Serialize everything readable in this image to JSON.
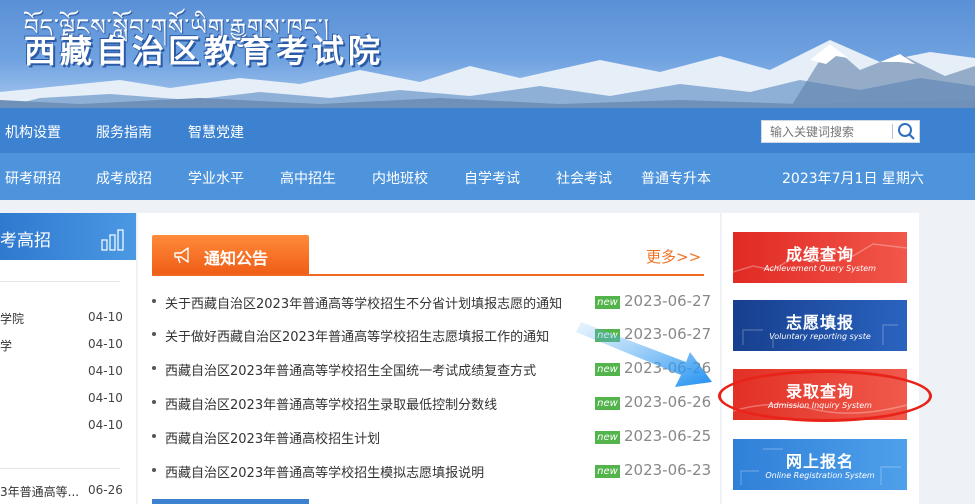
{
  "header": {
    "tibetan_title": "བོད་ལྗོངས་སློབ་གསོ་ཡིག་རྒྱུགས་ཁང་།",
    "site_title": "西藏自治区教育考试院"
  },
  "nav_primary": [
    "机构设置",
    "服务指南",
    "智慧党建"
  ],
  "search": {
    "placeholder": "输入关键词搜索",
    "icon": "search-icon"
  },
  "nav_secondary": [
    "研考研招",
    "成考成招",
    "学业水平",
    "高中招生",
    "内地班校",
    "自学考试",
    "社会考试",
    "普通专升本"
  ],
  "date_text": "2023年7月1日 星期六",
  "left_panel": {
    "title": "考高招",
    "icon": "chart-icon",
    "items": [
      {
        "title": "学院",
        "date": "04-10"
      },
      {
        "title": "学",
        "date": "04-10"
      },
      {
        "title": "",
        "date": "04-10"
      },
      {
        "title": "",
        "date": "04-10"
      },
      {
        "title": "",
        "date": "04-10"
      },
      {
        "title": "3年普通高等...",
        "date": "06-26"
      }
    ]
  },
  "notices": {
    "tab_label": "通知公告",
    "tab_icon": "megaphone-icon",
    "more_label": "更多>>",
    "badge_text": "new",
    "items": [
      {
        "title": "关于西藏自治区2023年普通高等学校招生不分省计划填报志愿的通知",
        "date": "2023-06-27"
      },
      {
        "title": "关于做好西藏自治区2023年普通高等学校招生志愿填报工作的通知",
        "date": "2023-06-27"
      },
      {
        "title": "西藏自治区2023年普通高等学校招生全国统一考试成绩复查方式",
        "date": "2023-06-26"
      },
      {
        "title": "西藏自治区2023年普通高等学校招生录取最低控制分数线",
        "date": "2023-06-26"
      },
      {
        "title": "西藏自治区2023年普通高校招生计划",
        "date": "2023-06-25"
      },
      {
        "title": "西藏自治区2023年普通高等学校招生模拟志愿填报说明",
        "date": "2023-06-23"
      }
    ]
  },
  "quick_links": [
    {
      "cn": "成绩查询",
      "en": "Achievement Query System",
      "color": "#e8322a"
    },
    {
      "cn": "志愿填报",
      "en": "Voluntary reporting syste",
      "color": "#1f4fa8"
    },
    {
      "cn": "录取查询",
      "en": "Admission Inquiry System",
      "color": "#ea3a2e"
    },
    {
      "cn": "网上报名",
      "en": "Online Registration System",
      "color": "#3b8ede"
    }
  ],
  "colors": {
    "nav_primary": "#3c82d1",
    "nav_secondary": "#4e94dd",
    "accent_orange": "#ef6a20",
    "highlight_red": "#e8231a"
  }
}
